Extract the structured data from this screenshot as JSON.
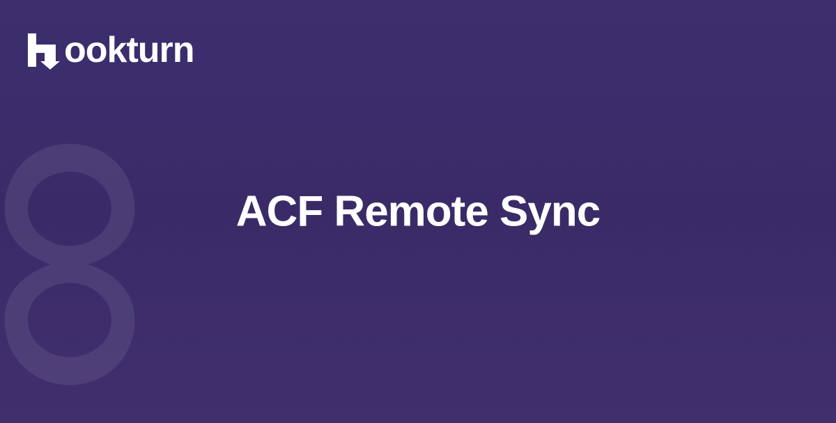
{
  "brand": {
    "name": "Hookturn",
    "logo_text": "ookturn"
  },
  "hero": {
    "title": "ACF Remote Sync"
  },
  "colors": {
    "background_start": "#3d2e6e",
    "background_end": "#412f6d",
    "text": "#ffffff"
  }
}
